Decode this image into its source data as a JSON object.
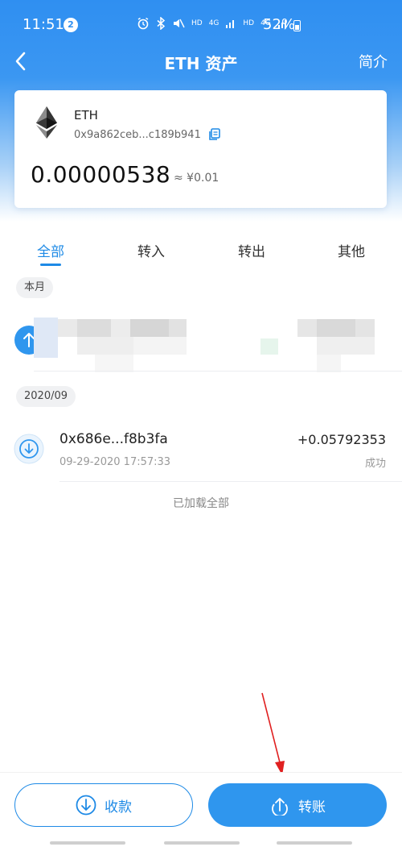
{
  "status_bar": {
    "time": "11:51",
    "notification_count": "2",
    "network_hd_1": "HD",
    "network_4g_1": "4G",
    "network_hd_2": "HD",
    "network_4g_2": "4G",
    "battery": "52%"
  },
  "nav": {
    "title": "ETH 资产",
    "intro_label": "简介"
  },
  "asset": {
    "symbol": "ETH",
    "address": "0x9a862ceb...c189b941",
    "balance": "0.00000538",
    "fiat_value": "≈ ¥0.01"
  },
  "tabs": [
    {
      "label": "全部",
      "active": true
    },
    {
      "label": "转入",
      "active": false
    },
    {
      "label": "转出",
      "active": false
    },
    {
      "label": "其他",
      "active": false
    }
  ],
  "sections": [
    {
      "title": "本月",
      "transactions": [
        {
          "direction": "out",
          "hash": "",
          "time": "",
          "amount": "",
          "status": ""
        }
      ]
    },
    {
      "title": "2020/09",
      "transactions": [
        {
          "direction": "in",
          "hash": "0x686e...f8b3fa",
          "time": "09-29-2020 17:57:33",
          "amount": "+0.05792353",
          "status": "成功"
        }
      ]
    }
  ],
  "footer_text": "已加载全部",
  "bottom_actions": {
    "receive_label": "收款",
    "transfer_label": "转账"
  },
  "colors": {
    "accent": "#1e8ae6",
    "header_blue": "#2f8ff1",
    "annotation_arrow": "#e02020"
  },
  "icons": {
    "back": "chevron-left-icon",
    "eth": "ethereum-logo-icon",
    "copy": "copy-icon",
    "incoming": "download-arrow-icon",
    "outgoing": "upload-arrow-icon"
  }
}
